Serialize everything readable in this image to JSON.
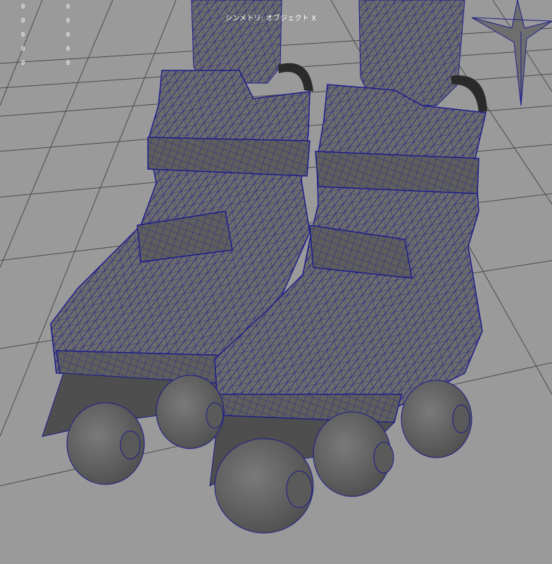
{
  "viewport": {
    "background": "#9a9a9a",
    "grid_color": "#4a4a4a",
    "wireframe_color": "#1c1c8c",
    "mesh_fill": "#6c6c6c",
    "symmetry_label": "シンメトリ: オブジェクト X"
  },
  "hud": {
    "rows": [
      {
        "a": "0",
        "b": "0"
      },
      {
        "a": "0",
        "b": "0"
      },
      {
        "a": "0",
        "b": "0"
      },
      {
        "a": "0",
        "b": "0"
      },
      {
        "a": "0",
        "b": "0"
      }
    ]
  },
  "icons": {
    "manipulator": "star-manipulator-icon"
  }
}
